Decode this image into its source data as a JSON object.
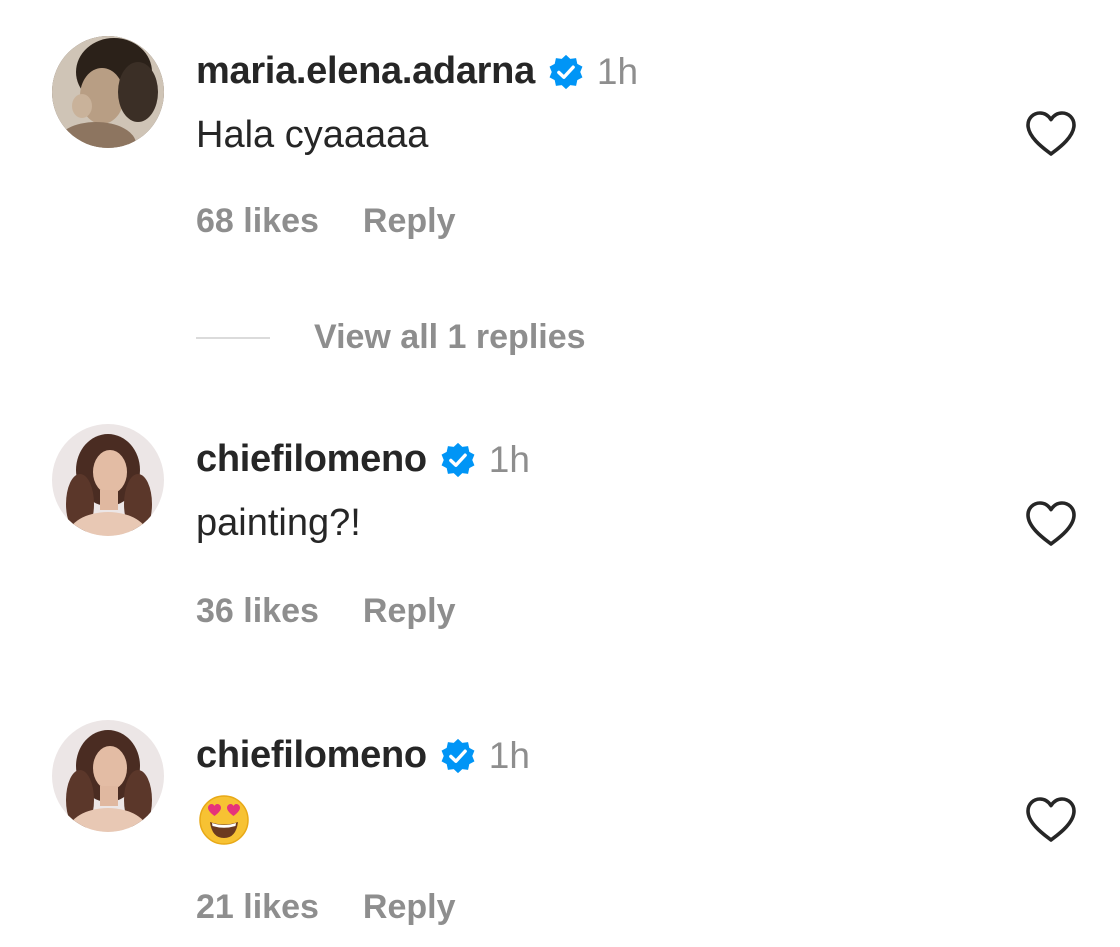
{
  "comments": [
    {
      "username": "maria.elena.adarna",
      "time": "1h",
      "text": "Hala cyaaaaa",
      "likes": "68 likes",
      "reply": "Reply",
      "avatar_icon": "avatar-photo-icon",
      "verified_icon": "verified-badge-icon"
    },
    {
      "username": "chiefilomeno",
      "time": "1h",
      "text": "painting?!",
      "likes": "36 likes",
      "reply": "Reply",
      "avatar_icon": "avatar-photo-icon",
      "verified_icon": "verified-badge-icon"
    },
    {
      "username": "chiefilomeno",
      "time": "1h",
      "text": "",
      "emoji": "smiling-face-with-heart-eyes",
      "likes": "21 likes",
      "reply": "Reply",
      "avatar_icon": "avatar-photo-icon",
      "verified_icon": "verified-badge-icon"
    }
  ],
  "view_replies": "View all 1 replies",
  "colors": {
    "text": "#262626",
    "secondary": "#8e8e8e",
    "verified": "#0095f6",
    "divider": "#dbdbdb"
  }
}
